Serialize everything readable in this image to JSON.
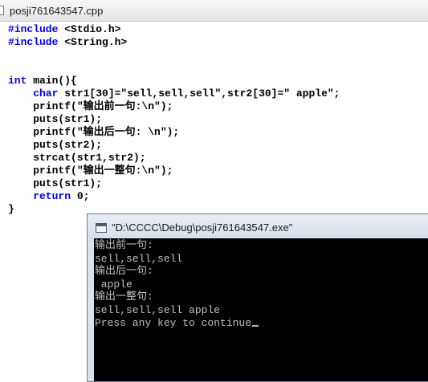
{
  "editor": {
    "tab_title": "posji761643547.cpp",
    "lines": [
      {
        "kw": "#include",
        "rest": " <Stdio.h>"
      },
      {
        "kw": "#include",
        "rest": " <String.h>"
      },
      {
        "kw": "",
        "rest": ""
      },
      {
        "kw": "",
        "rest": ""
      },
      {
        "kw": "int",
        "rest": " main(){"
      },
      {
        "kw": "    char",
        "rest": " str1[30]=\"sell,sell,sell\",str2[30]=\" apple\";"
      },
      {
        "kw": "",
        "rest": "    printf(\"输出前一句:\\n\");"
      },
      {
        "kw": "",
        "rest": "    puts(str1);"
      },
      {
        "kw": "",
        "rest": "    printf(\"输出后一句: \\n\");"
      },
      {
        "kw": "",
        "rest": "    puts(str2);"
      },
      {
        "kw": "",
        "rest": "    strcat(str1,str2);"
      },
      {
        "kw": "",
        "rest": "    printf(\"输出一整句:\\n\");"
      },
      {
        "kw": "",
        "rest": "    puts(str1);"
      },
      {
        "kw": "    return",
        "rest": " 0;"
      },
      {
        "kw": "",
        "rest": "}"
      }
    ]
  },
  "console": {
    "title": "\"D:\\CCCC\\Debug\\posji761643547.exe\"",
    "lines": [
      "输出前一句:",
      "sell,sell,sell",
      "输出后一句:",
      " apple",
      "输出一整句:",
      "sell,sell,sell apple",
      "Press any key to continue"
    ]
  },
  "colors": {
    "keyword": "#0000ff",
    "console_bg": "#000000",
    "console_text": "#c0c0c0"
  }
}
